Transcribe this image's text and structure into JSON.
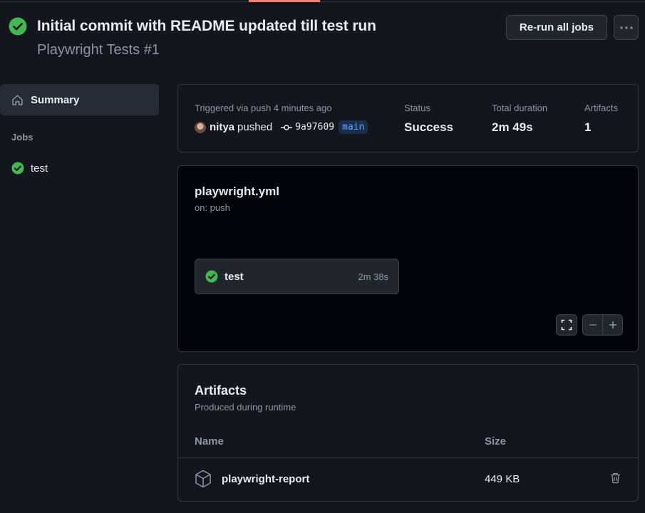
{
  "colors": {
    "success": "#3fb950",
    "accent": "#f78166",
    "branch": "#58a6ff"
  },
  "header": {
    "title": "Initial commit with README updated till test run",
    "subtitle": "Playwright Tests #1",
    "rerun_label": "Re-run all jobs",
    "more_icon": "kebab-horizontal-icon"
  },
  "sidebar": {
    "summary_label": "Summary",
    "jobs_heading": "Jobs",
    "jobs": [
      {
        "label": "test",
        "status": "success"
      }
    ]
  },
  "summary": {
    "triggered_label": "Triggered via push 4 minutes ago",
    "pusher": "nitya",
    "pushed_text": "pushed",
    "commit_sha": "9a97609",
    "branch": "main",
    "status_label": "Status",
    "status_value": "Success",
    "duration_label": "Total duration",
    "duration_value": "2m 49s",
    "artifacts_label": "Artifacts",
    "artifacts_value": "1"
  },
  "workflow": {
    "name": "playwright.yml",
    "trigger": "on: push",
    "job": {
      "name": "test",
      "duration": "2m 38s",
      "status": "success"
    }
  },
  "artifacts": {
    "title": "Artifacts",
    "subtitle": "Produced during runtime",
    "col_name": "Name",
    "col_size": "Size",
    "rows": [
      {
        "name": "playwright-report",
        "size": "449 KB"
      }
    ]
  }
}
